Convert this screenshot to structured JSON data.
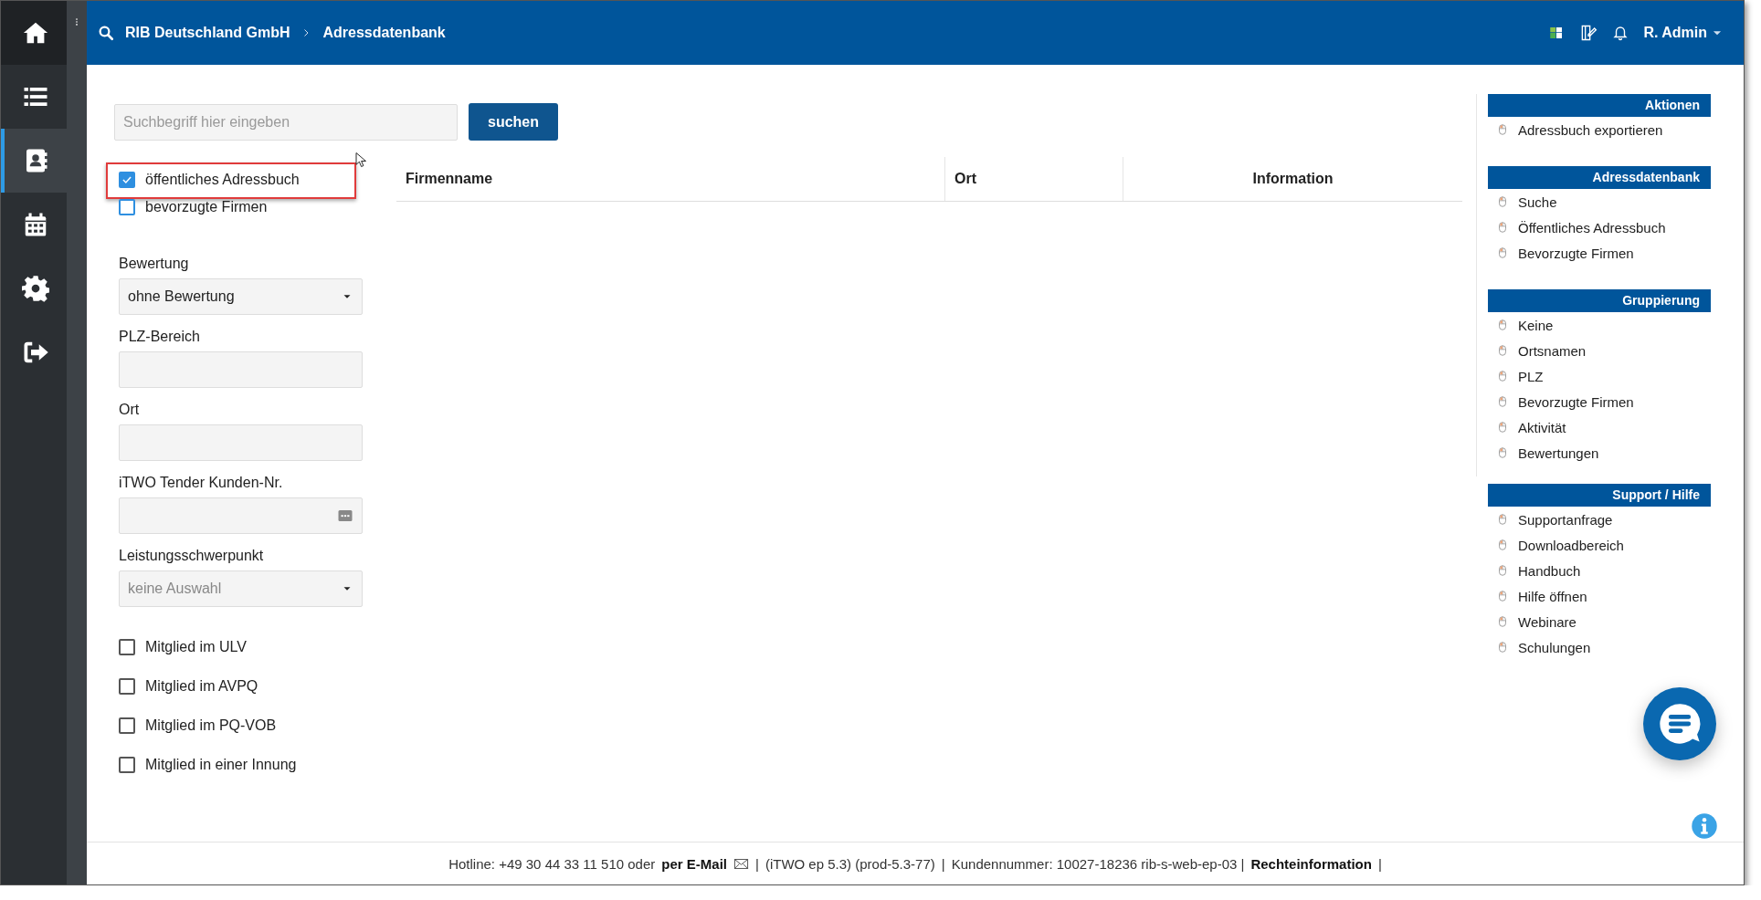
{
  "nav_items": [
    {
      "kind": "home",
      "selected": false
    },
    {
      "kind": "list",
      "selected": false
    },
    {
      "kind": "contacts",
      "selected": true
    },
    {
      "kind": "calendar",
      "selected": false
    },
    {
      "kind": "settings",
      "selected": false
    },
    {
      "kind": "logout",
      "selected": false
    }
  ],
  "topbar": {
    "breadcrumb": [
      "RIB Deutschland GmbH",
      "Adressdatenbank"
    ],
    "user": "R. Admin"
  },
  "search": {
    "placeholder": "Suchbegriff hier eingeben",
    "button": "suchen"
  },
  "filters": [
    {
      "label": "öffentliches Adressbuch",
      "checked": true,
      "highlighted": true
    },
    {
      "label": "bevorzugte Firmen",
      "checked": false,
      "highlighted": false
    }
  ],
  "fields": [
    {
      "label": "Bewertung",
      "kind": "select",
      "value": "ohne Bewertung"
    },
    {
      "label": "PLZ-Bereich",
      "kind": "text"
    },
    {
      "label": "Ort",
      "kind": "text"
    },
    {
      "label": "iTWO Tender Kunden-Nr.",
      "kind": "picker"
    },
    {
      "label": "Leistungsschwerpunkt",
      "kind": "select",
      "placeholder": "keine Auswahl"
    }
  ],
  "memberships": [
    {
      "label": "Mitglied im ULV",
      "checked": false
    },
    {
      "label": "Mitglied im AVPQ",
      "checked": false
    },
    {
      "label": "Mitglied im PQ-VOB",
      "checked": false
    },
    {
      "label": "Mitglied in einer Innung",
      "checked": false
    }
  ],
  "table": {
    "columns": [
      "Firmenname",
      "Ort",
      "Information"
    ]
  },
  "side_menu": [
    {
      "title": "Aktionen",
      "items": [
        "Adressbuch exportieren"
      ]
    },
    {
      "title": "Adressdatenbank",
      "items": [
        "Suche",
        "Öffentliches Adressbuch",
        "Bevorzugte Firmen"
      ]
    },
    {
      "title": "Gruppierung",
      "items": [
        "Keine",
        "Ortsnamen",
        "PLZ",
        "Bevorzugte Firmen",
        "Aktivität",
        "Bewertungen"
      ]
    },
    {
      "title": "Support / Hilfe",
      "items": [
        "Supportanfrage",
        "Downloadbereich",
        "Handbuch",
        "Hilfe öffnen",
        "Webinare",
        "Schulungen"
      ]
    }
  ],
  "footer": [
    {
      "kind": "text",
      "text": "Hotline: +49 30 44 33 11 510 oder"
    },
    {
      "kind": "link",
      "text": "per E-Mail"
    },
    {
      "kind": "mail"
    },
    {
      "kind": "text",
      "text": "|"
    },
    {
      "kind": "text",
      "text": "(iTWO ep 5.3) (prod-5.3-77)"
    },
    {
      "kind": "text",
      "text": "|"
    },
    {
      "kind": "text",
      "text": "Kundennummer: 10027-18236 rib-s-web-ep-03 |"
    },
    {
      "kind": "link",
      "text": "Rechteinformation"
    },
    {
      "kind": "text",
      "text": "|"
    }
  ]
}
